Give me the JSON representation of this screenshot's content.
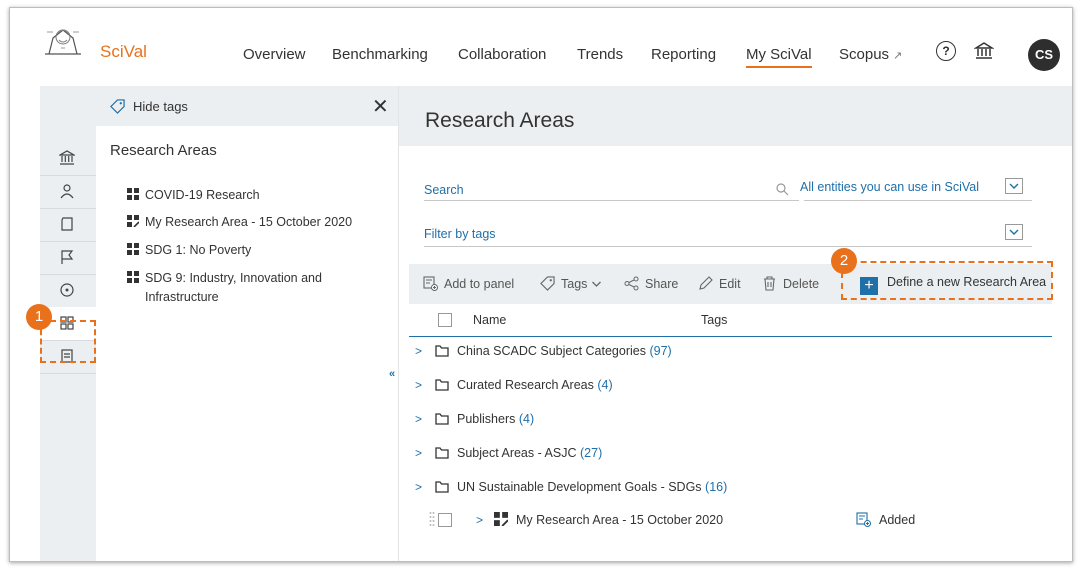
{
  "header": {
    "brand": "SciVal",
    "nav": [
      {
        "label": "Overview"
      },
      {
        "label": "Benchmarking"
      },
      {
        "label": "Collaboration"
      },
      {
        "label": "Trends"
      },
      {
        "label": "Reporting"
      },
      {
        "label": "My SciVal",
        "active": true
      },
      {
        "label": "Scopus",
        "external": true
      }
    ],
    "external_glyph": "↗",
    "help_glyph": "?",
    "avatar_initials": "CS"
  },
  "tag_panel": {
    "hide_tags_label": "Hide tags",
    "close_glyph": "✕",
    "title": "Research Areas",
    "items": [
      {
        "label": "COVID-19 Research",
        "icon": "grid-icon"
      },
      {
        "label": "My Research Area - 15 October 2020",
        "icon": "grid-edit-icon"
      },
      {
        "label": "SDG 1: No Poverty",
        "icon": "grid-icon"
      },
      {
        "label": "SDG 9: Industry, Innovation and",
        "label2": "Infrastructure",
        "icon": "grid-icon"
      }
    ]
  },
  "rail": {
    "items": [
      "institution-icon",
      "person-icon",
      "publication-icon",
      "flag-icon",
      "target-icon",
      "research-area-icon",
      "report-icon"
    ],
    "selected": "research-area-icon"
  },
  "main": {
    "title": "Research Areas",
    "search": {
      "label": "Search"
    },
    "entities_select": {
      "value": "All entities you can use in SciVal"
    },
    "filter": {
      "label": "Filter by tags"
    },
    "toolbar": {
      "add_to_panel": "Add to panel",
      "tags": "Tags",
      "share": "Share",
      "edit": "Edit",
      "delete": "Delete"
    },
    "define_button": "Define a new Research Area",
    "columns": {
      "name": "Name",
      "tags": "Tags"
    },
    "rows": [
      {
        "name": "China SCADC Subject Categories",
        "count": "(97)"
      },
      {
        "name": "Curated Research Areas",
        "count": "(4)"
      },
      {
        "name": "Publishers",
        "count": "(4)"
      },
      {
        "name": "Subject Areas - ASJC",
        "count": "(27)"
      },
      {
        "name": "UN Sustainable Development Goals - SDGs",
        "count": "(16)"
      }
    ],
    "my_area_row": {
      "name": "My Research Area - 15 October 2020",
      "status": "Added"
    }
  },
  "annotations": {
    "marker1": "1",
    "marker2": "2"
  },
  "colors": {
    "accent": "#e9711c",
    "link": "#1f6fa8",
    "panel_bg": "#eceff1"
  }
}
